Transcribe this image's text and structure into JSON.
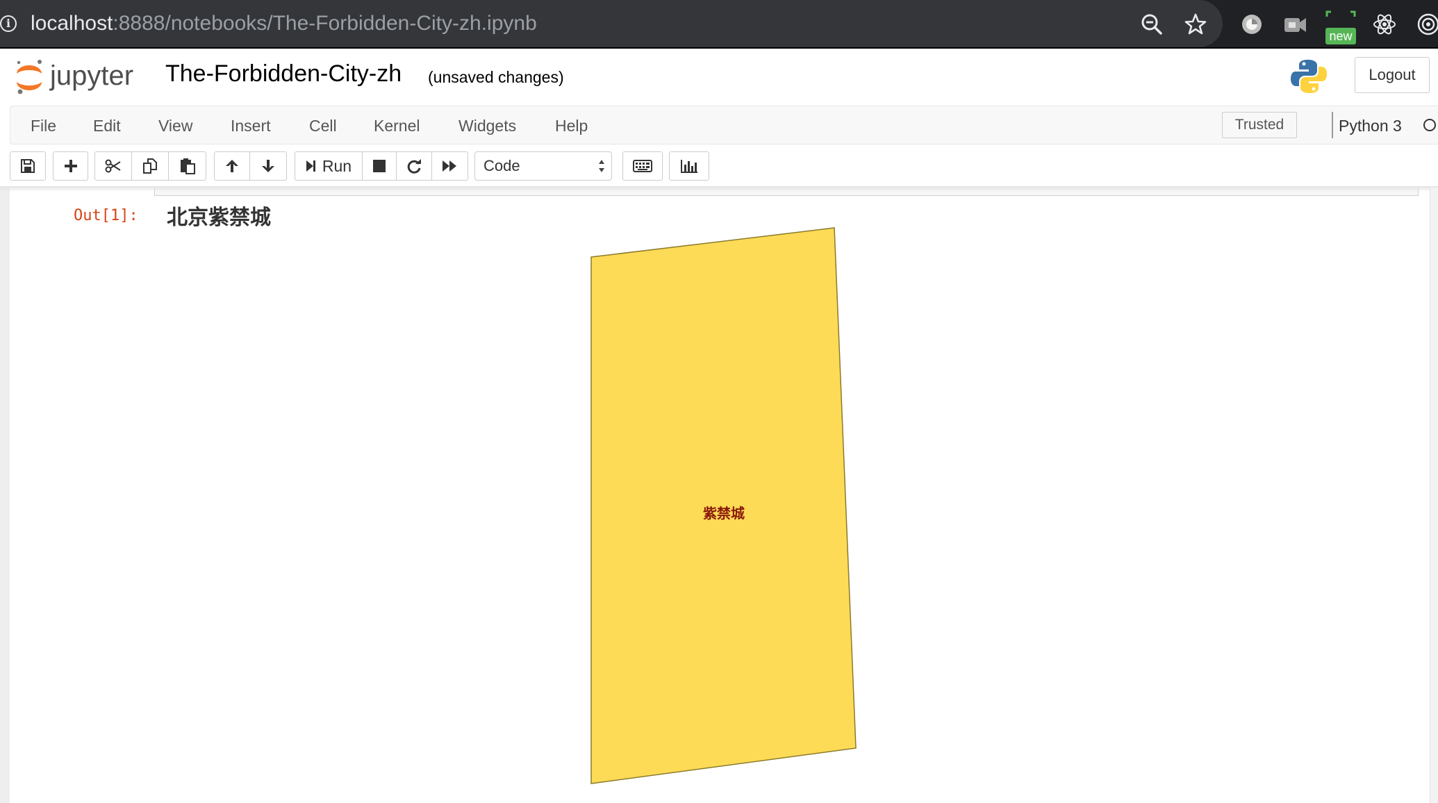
{
  "browser": {
    "url_host": "localhost",
    "url_rest": ":8888/notebooks/The-Forbidden-City-zh.ipynb",
    "new_badge": "new",
    "icons": [
      "info-icon",
      "zoom-out-icon",
      "bookmark-star-icon",
      "extension-circle-icon",
      "extension-camera-icon",
      "extension-new-icon",
      "react-devtools-icon",
      "extension-target-icon"
    ]
  },
  "header": {
    "logo_text": "jupyter",
    "notebook_title": "The-Forbidden-City-zh",
    "save_status": "(unsaved changes)",
    "logout_label": "Logout"
  },
  "menu": {
    "items": [
      {
        "label": "File"
      },
      {
        "label": "Edit"
      },
      {
        "label": "View"
      },
      {
        "label": "Insert"
      },
      {
        "label": "Cell"
      },
      {
        "label": "Kernel"
      },
      {
        "label": "Widgets"
      },
      {
        "label": "Help"
      }
    ],
    "trusted_label": "Trusted",
    "kernel_name": "Python 3",
    "kernel_status": "idle"
  },
  "toolbar": {
    "run_label": "Run",
    "cell_type": "Code",
    "icons": [
      "save-icon",
      "plus-icon",
      "cut-icon",
      "copy-icon",
      "paste-icon",
      "arrow-up-icon",
      "arrow-down-icon",
      "run-icon",
      "stop-icon",
      "restart-icon",
      "fast-forward-icon",
      "keyboard-icon",
      "bar-chart-icon"
    ]
  },
  "output": {
    "prompt": "Out[1]:",
    "title": "北京紫禁城",
    "map_label": "紫禁城",
    "polygon_fill": "#fddb56",
    "polygon_stroke": "#8a7a2a",
    "label_color": "#8b1a0a"
  }
}
